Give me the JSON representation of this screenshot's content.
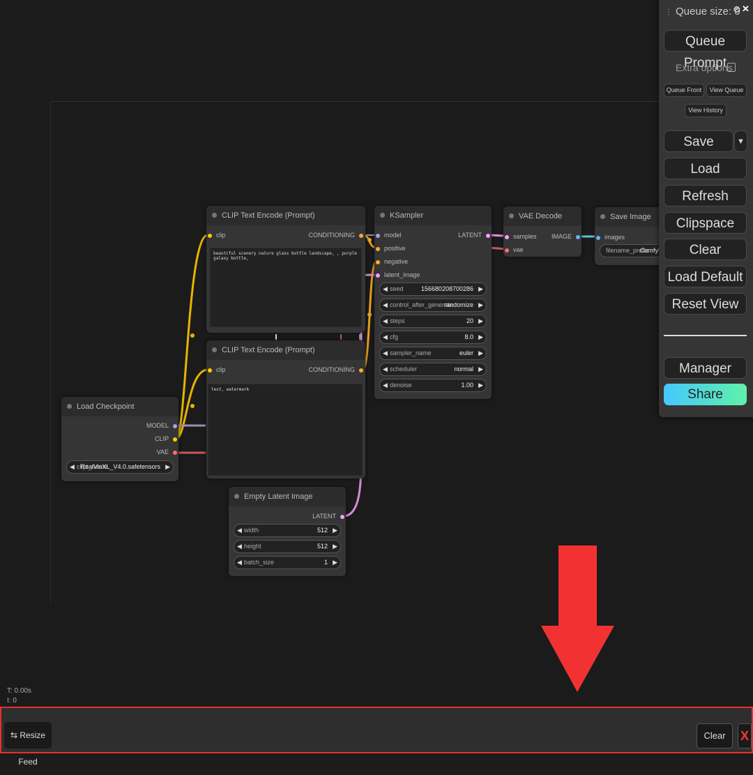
{
  "stats": {
    "time": "T: 0.00s",
    "iterations": "I: 0"
  },
  "nodes": {
    "clip1": {
      "title": "CLIP Text Encode (Prompt)",
      "input": "clip",
      "output": "CONDITIONING",
      "text": "beautiful scenery nature glass bottle landscape, , purple galaxy bottle,"
    },
    "clip2": {
      "title": "CLIP Text Encode (Prompt)",
      "input": "clip",
      "output": "CONDITIONING",
      "text": "text, watermark"
    },
    "ksampler": {
      "title": "KSampler",
      "inputs": [
        "model",
        "positive",
        "negative",
        "latent_image"
      ],
      "output": "LATENT",
      "widgets": [
        {
          "name": "seed",
          "value": "156680208700286"
        },
        {
          "name": "control_after_generate",
          "value": "randomize"
        },
        {
          "name": "steps",
          "value": "20"
        },
        {
          "name": "cfg",
          "value": "8.0"
        },
        {
          "name": "sampler_name",
          "value": "euler"
        },
        {
          "name": "scheduler",
          "value": "normal"
        },
        {
          "name": "denoise",
          "value": "1.00"
        }
      ]
    },
    "vae_decode": {
      "title": "VAE Decode",
      "inputs": [
        "samples",
        "vae"
      ],
      "output": "IMAGE"
    },
    "save_image": {
      "title": "Save Image",
      "input": "images",
      "widget_name": "filename_prefix",
      "widget_value": "ComfyUI"
    },
    "checkpoint": {
      "title": "Load Checkpoint",
      "outputs": [
        "MODEL",
        "CLIP",
        "VAE"
      ],
      "widget_name": "ckpt_name",
      "widget_value": "RealVisXL_V4.0.safetensors"
    },
    "latent": {
      "title": "Empty Latent Image",
      "output": "LATENT",
      "widgets": [
        {
          "name": "width",
          "value": "512"
        },
        {
          "name": "height",
          "value": "512"
        },
        {
          "name": "batch_size",
          "value": "1"
        }
      ]
    }
  },
  "menu": {
    "queue_size": "Queue size: 0",
    "queue_prompt": "Queue Prompt",
    "extra_options": "Extra options",
    "queue_front": "Queue Front",
    "view_queue": "View Queue",
    "view_history": "View History",
    "save": "Save",
    "save_dropdown": "▼",
    "load": "Load",
    "refresh": "Refresh",
    "clipspace": "Clipspace",
    "clear": "Clear",
    "load_default": "Load Default",
    "reset_view": "Reset View",
    "manager": "Manager",
    "share": "Share"
  },
  "feed": {
    "resize_feed": "Resize Feed",
    "clear": "Clear",
    "close": "X"
  },
  "colors": {
    "clip": "#ffcc00",
    "model": "#b39ddb",
    "vae": "#ff6e6e",
    "latent": "#ff9cf9",
    "image": "#64b5f6",
    "conditioning": "#ffa931",
    "annotation_arrow": "#f23232"
  }
}
